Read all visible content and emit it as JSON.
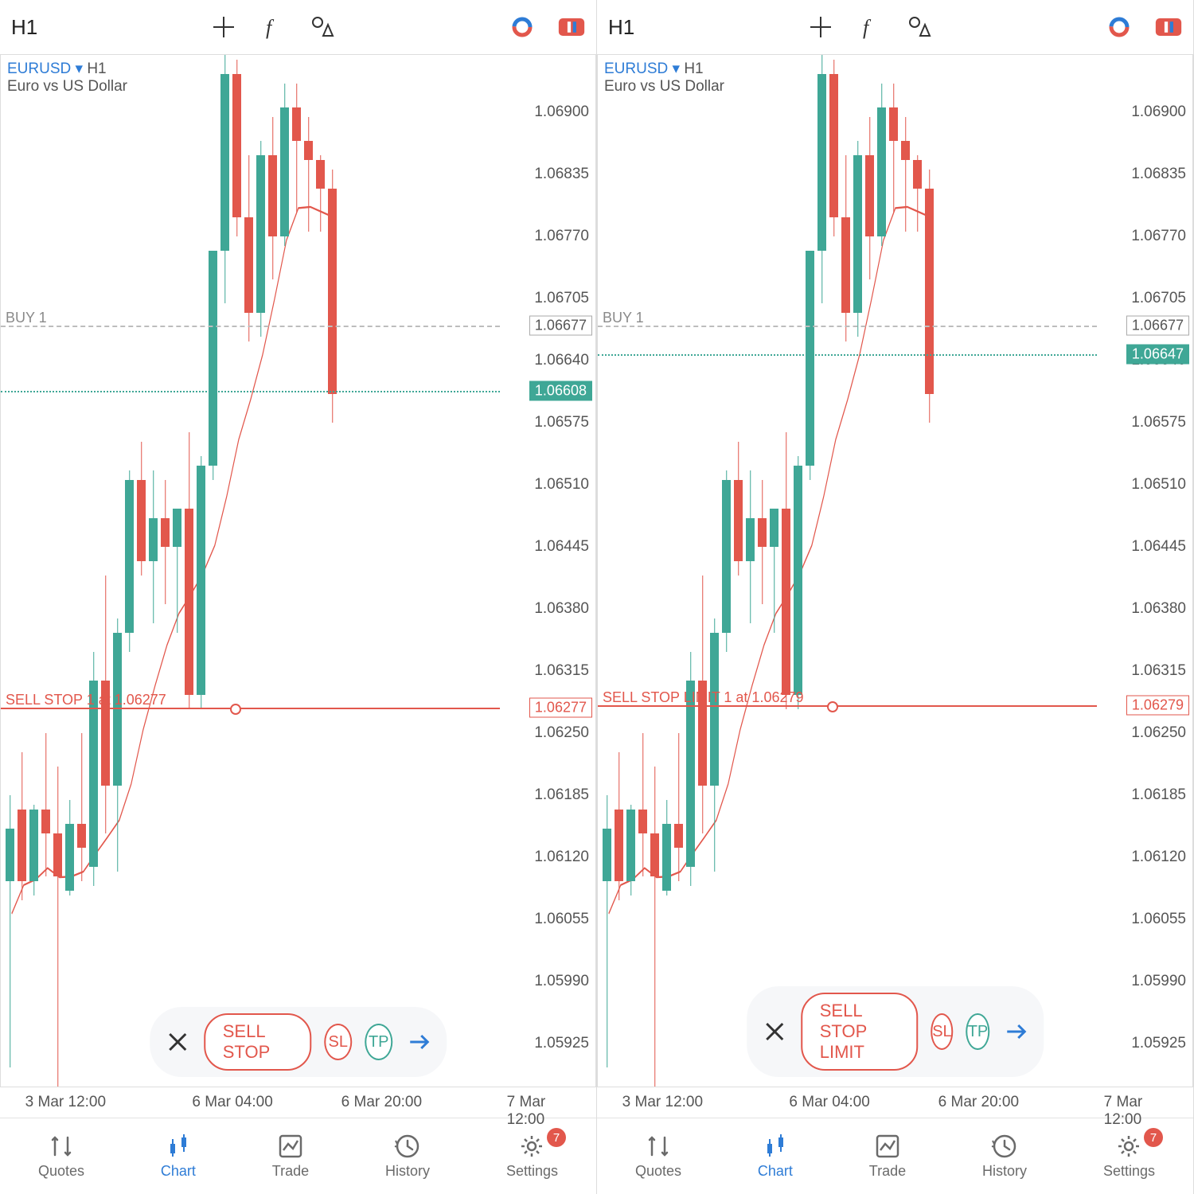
{
  "chart_data": {
    "type": "candlestick",
    "symbol": "EURUSD",
    "timeframe": "H1",
    "description": "Euro vs US Dollar",
    "y_ticks": [
      1.05925,
      1.0599,
      1.06055,
      1.0612,
      1.06185,
      1.0625,
      1.06315,
      1.0638,
      1.06445,
      1.0651,
      1.06575,
      1.0664,
      1.06705,
      1.0677,
      1.06835,
      1.069
    ],
    "x_ticks": [
      "3 Mar 12:00",
      "6 Mar 04:00",
      "6 Mar 20:00",
      "7 Mar 12:00"
    ],
    "indicator": {
      "name": "moving-average",
      "color": "#e2574c"
    },
    "series": [
      {
        "name": "left-panel",
        "current_price": 1.06608,
        "buy_line": {
          "label": "BUY 1",
          "price": 1.06677
        },
        "order_line": {
          "label": "SELL STOP 1 at 1.06277",
          "price": 1.06277
        }
      },
      {
        "name": "right-panel",
        "current_price": 1.06647,
        "buy_line": {
          "label": "BUY 1",
          "price": 1.06677
        },
        "order_line": {
          "label": "SELL STOP LIMIT 1 at 1.06279",
          "price": 1.06279
        }
      }
    ],
    "candles": [
      {
        "o": 1.06095,
        "h": 1.06185,
        "l": 1.059,
        "c": 1.0615,
        "dir": "up"
      },
      {
        "o": 1.0617,
        "h": 1.0623,
        "l": 1.06075,
        "c": 1.06095,
        "dir": "down"
      },
      {
        "o": 1.06095,
        "h": 1.06175,
        "l": 1.0608,
        "c": 1.0617,
        "dir": "up"
      },
      {
        "o": 1.0617,
        "h": 1.0625,
        "l": 1.061,
        "c": 1.06145,
        "dir": "down"
      },
      {
        "o": 1.06145,
        "h": 1.06215,
        "l": 1.0587,
        "c": 1.061,
        "dir": "down"
      },
      {
        "o": 1.06085,
        "h": 1.0618,
        "l": 1.0608,
        "c": 1.06155,
        "dir": "up"
      },
      {
        "o": 1.06155,
        "h": 1.0625,
        "l": 1.06095,
        "c": 1.0613,
        "dir": "down"
      },
      {
        "o": 1.0611,
        "h": 1.06335,
        "l": 1.0609,
        "c": 1.06305,
        "dir": "up"
      },
      {
        "o": 1.06305,
        "h": 1.06415,
        "l": 1.06145,
        "c": 1.06195,
        "dir": "down"
      },
      {
        "o": 1.06195,
        "h": 1.0637,
        "l": 1.06105,
        "c": 1.06355,
        "dir": "up"
      },
      {
        "o": 1.06355,
        "h": 1.06525,
        "l": 1.06335,
        "c": 1.06515,
        "dir": "up"
      },
      {
        "o": 1.06515,
        "h": 1.06555,
        "l": 1.06415,
        "c": 1.0643,
        "dir": "down"
      },
      {
        "o": 1.0643,
        "h": 1.06525,
        "l": 1.06365,
        "c": 1.06475,
        "dir": "up"
      },
      {
        "o": 1.06475,
        "h": 1.06515,
        "l": 1.06385,
        "c": 1.06445,
        "dir": "down"
      },
      {
        "o": 1.06445,
        "h": 1.06485,
        "l": 1.06355,
        "c": 1.06485,
        "dir": "up"
      },
      {
        "o": 1.06485,
        "h": 1.06565,
        "l": 1.06275,
        "c": 1.0629,
        "dir": "down"
      },
      {
        "o": 1.0629,
        "h": 1.0654,
        "l": 1.06275,
        "c": 1.0653,
        "dir": "up"
      },
      {
        "o": 1.0653,
        "h": 1.06755,
        "l": 1.06515,
        "c": 1.06755,
        "dir": "up"
      },
      {
        "o": 1.06755,
        "h": 1.0696,
        "l": 1.067,
        "c": 1.0694,
        "dir": "up"
      },
      {
        "o": 1.0694,
        "h": 1.06955,
        "l": 1.0677,
        "c": 1.0679,
        "dir": "down"
      },
      {
        "o": 1.0679,
        "h": 1.06855,
        "l": 1.0666,
        "c": 1.0669,
        "dir": "down"
      },
      {
        "o": 1.0669,
        "h": 1.0687,
        "l": 1.06665,
        "c": 1.06855,
        "dir": "up"
      },
      {
        "o": 1.06855,
        "h": 1.06895,
        "l": 1.06725,
        "c": 1.0677,
        "dir": "down"
      },
      {
        "o": 1.0677,
        "h": 1.0693,
        "l": 1.0676,
        "c": 1.06905,
        "dir": "up"
      },
      {
        "o": 1.06905,
        "h": 1.0693,
        "l": 1.06795,
        "c": 1.0687,
        "dir": "down"
      },
      {
        "o": 1.0687,
        "h": 1.06895,
        "l": 1.06775,
        "c": 1.0685,
        "dir": "down"
      },
      {
        "o": 1.0685,
        "h": 1.06855,
        "l": 1.06775,
        "c": 1.0682,
        "dir": "down"
      },
      {
        "o": 1.0682,
        "h": 1.0684,
        "l": 1.06575,
        "c": 1.06605,
        "dir": "down"
      }
    ]
  },
  "toolbar": {
    "timeframe": "H1"
  },
  "panels": [
    {
      "order_button": "SELL STOP",
      "sl": "SL",
      "tp": "TP"
    },
    {
      "order_button": "SELL STOP LIMIT",
      "sl": "SL",
      "tp": "TP"
    }
  ],
  "nav": {
    "items": [
      {
        "label": "Quotes"
      },
      {
        "label": "Chart"
      },
      {
        "label": "Trade"
      },
      {
        "label": "History"
      },
      {
        "label": "Settings",
        "badge": "7"
      }
    ]
  },
  "colors": {
    "up": "#3fa796",
    "down": "#e2574c",
    "accent_blue": "#2e7cd6",
    "axis": "#888"
  }
}
